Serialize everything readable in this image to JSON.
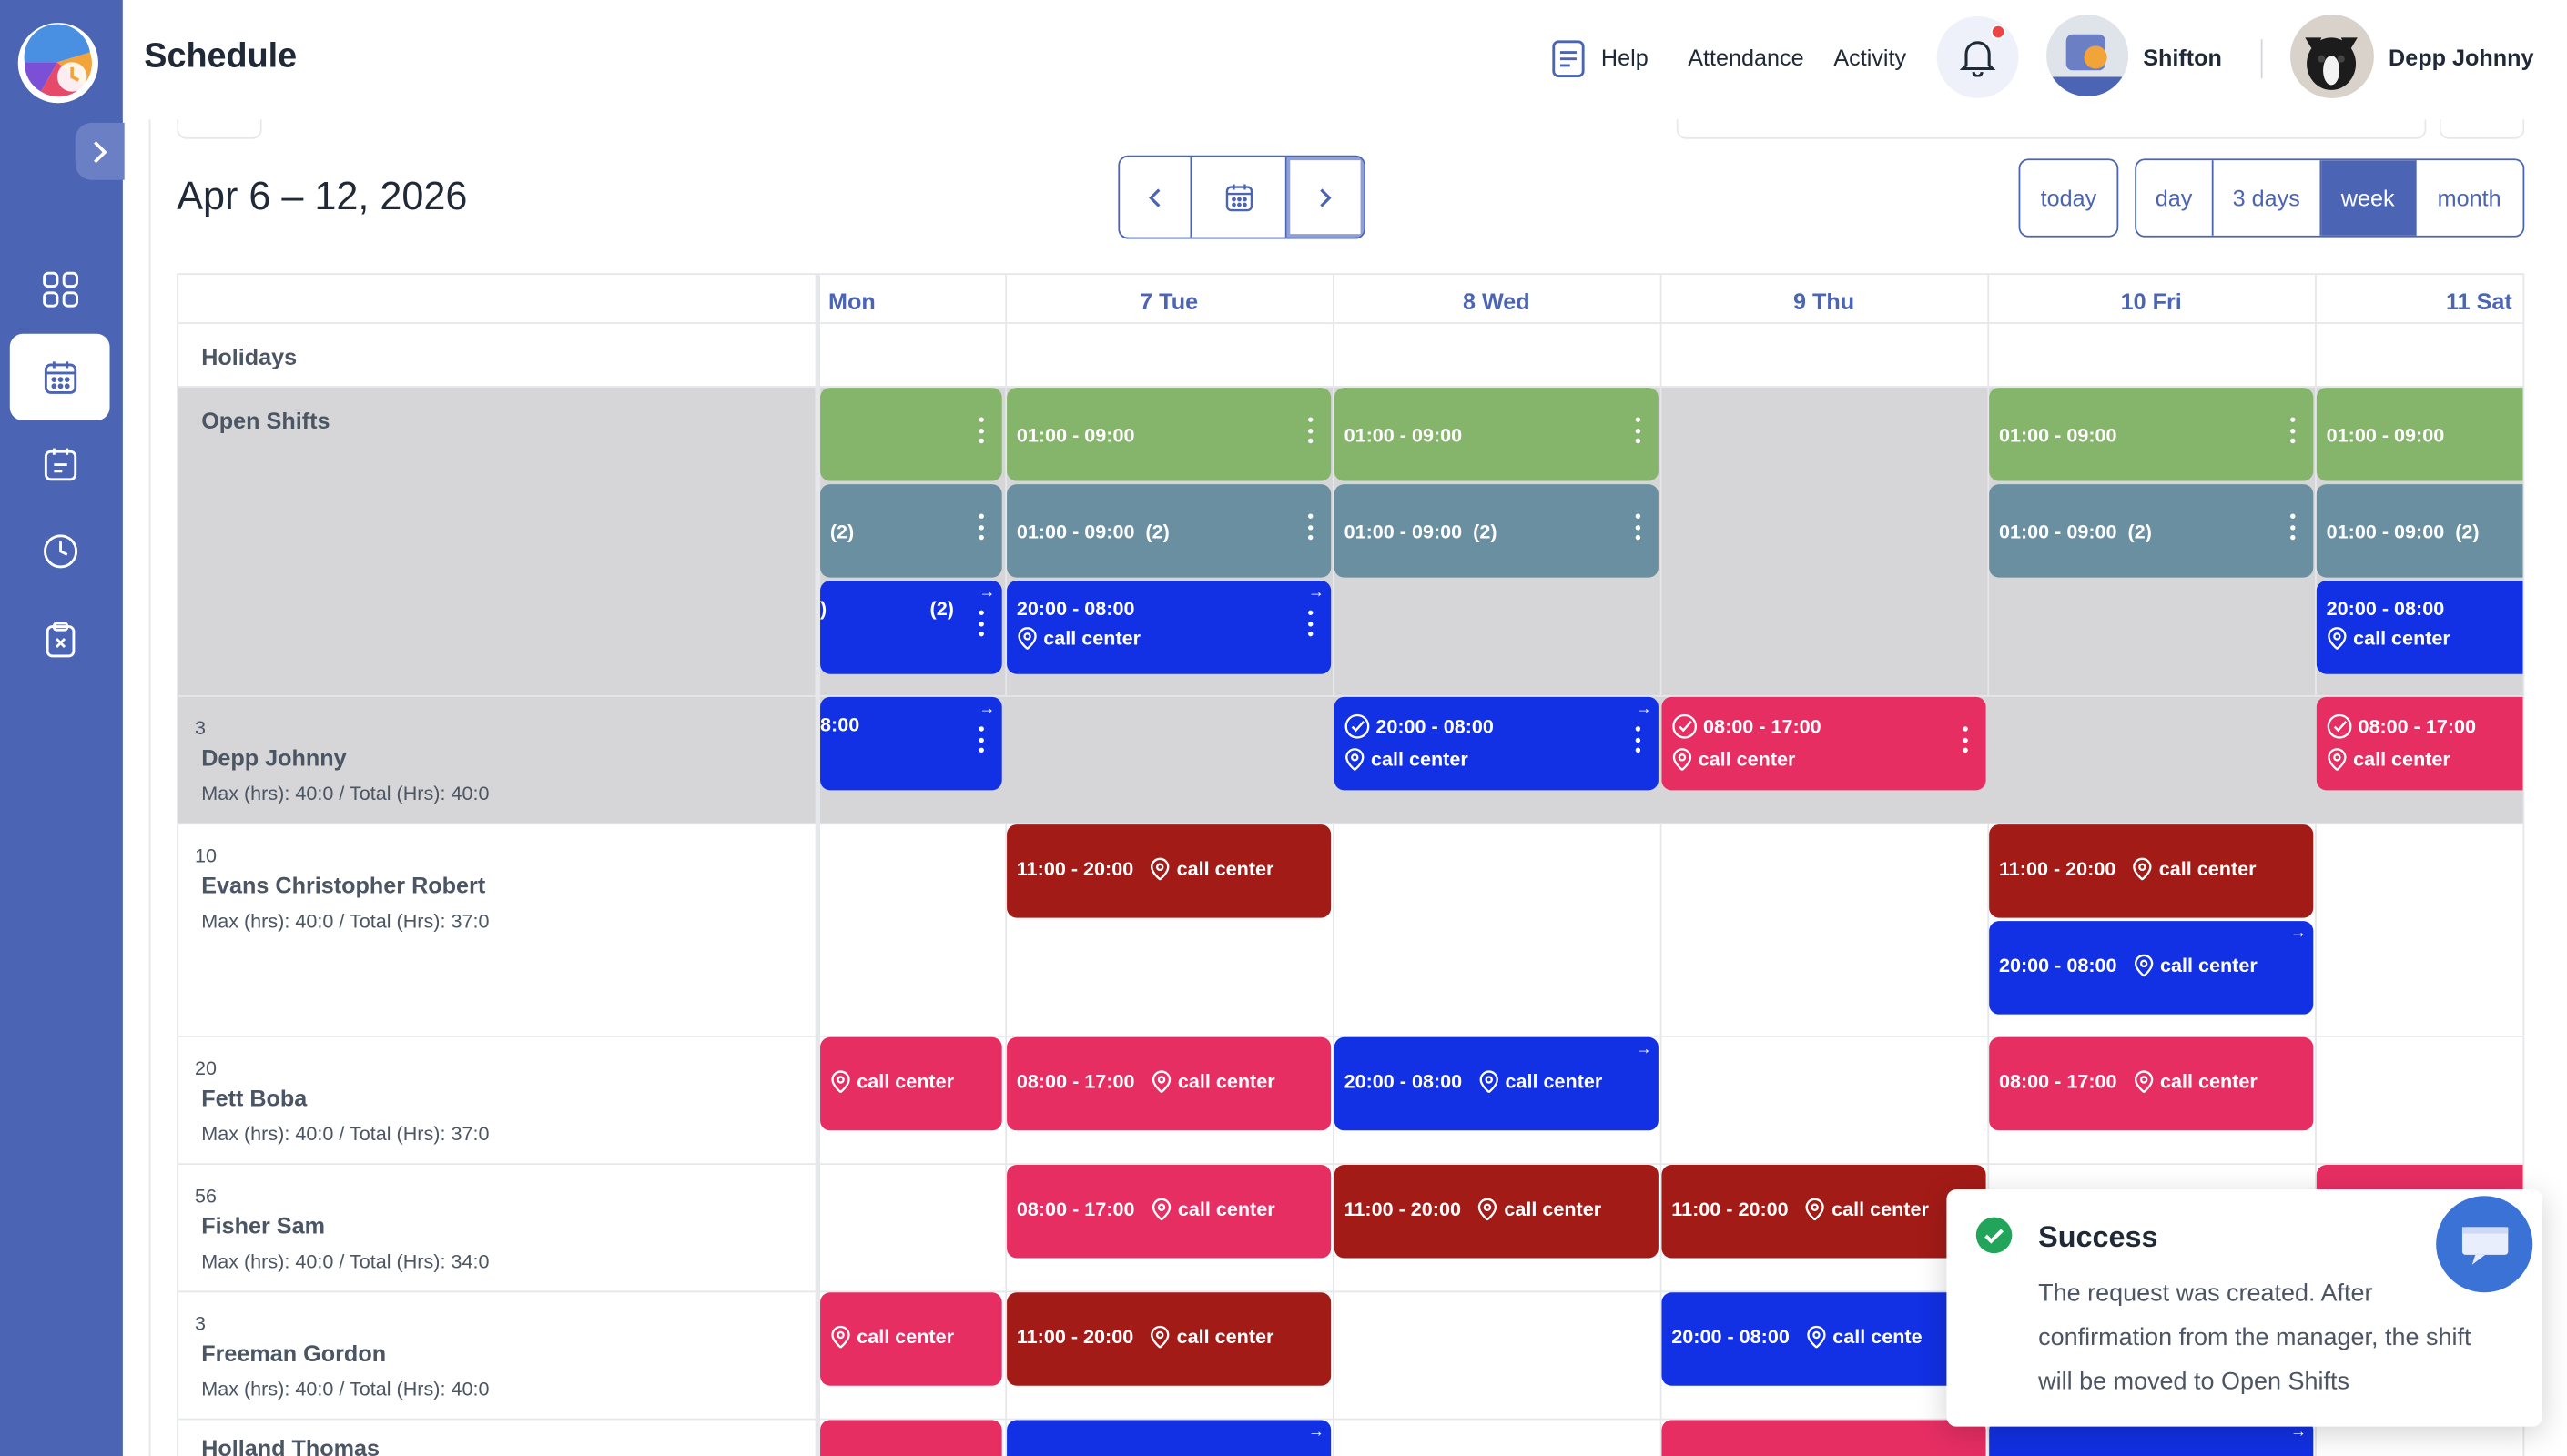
{
  "app": {
    "page_title": "Schedule"
  },
  "header": {
    "help": "Help",
    "attendance": "Attendance",
    "activity": "Activity",
    "company": "Shifton",
    "user": "Depp Johnny"
  },
  "toolbar": {
    "date_range": "Apr 6 – 12, 2026",
    "today": "today",
    "views": [
      "day",
      "3 days",
      "week",
      "month"
    ],
    "active_view": "week"
  },
  "days": [
    "Mon",
    "7 Tue",
    "8 Wed",
    "9 Thu",
    "10 Fri",
    "11 Sat"
  ],
  "rows": {
    "holidays": "Holidays",
    "open_shifts": "Open Shifts",
    "employees": [
      {
        "count": "3",
        "name": "Depp Johnny",
        "hours": "Max (hrs): 40:0 / Total (Hrs): 40:0"
      },
      {
        "count": "10",
        "name": "Evans Christopher Robert",
        "hours": "Max (hrs): 40:0 / Total (Hrs): 37:0"
      },
      {
        "count": "20",
        "name": "Fett Boba",
        "hours": "Max (hrs): 40:0 / Total (Hrs): 37:0"
      },
      {
        "count": "56",
        "name": "Fisher Sam",
        "hours": "Max (hrs): 40:0 / Total (Hrs): 34:0"
      },
      {
        "count": "3",
        "name": "Freeman Gordon",
        "hours": "Max (hrs): 40:0 / Total (Hrs): 40:0"
      },
      {
        "count": "",
        "name": "Holland Thomas",
        "hours": ""
      }
    ]
  },
  "shift_text": {
    "s0109": "01:00 - 09:00",
    "s0109x2": "01:00 - 09:00  (2)",
    "x2": "(2)",
    "s2008": "20:00 - 08:00",
    "s0817": "08:00 - 17:00",
    "s1120": "11:00 - 20:00",
    "call_center": "call center",
    "call_cente": "call cente",
    "partial_08": "8:00",
    "partial_0": ")"
  },
  "toast": {
    "title": "Success",
    "message": "The request was created. After confirmation from the manager, the shift will be moved to Open Shifts"
  },
  "colors": {
    "sidebar": "#4b64b4",
    "accent": "#4b64b4",
    "green": "#84b56a",
    "slate": "#6a8fa0",
    "blue": "#1230e4",
    "pink": "#e62e63",
    "maroon": "#a31b17",
    "success": "#22a55b"
  },
  "icons": {
    "sidebar": [
      "dashboard-icon",
      "calendar-icon",
      "tasks-icon",
      "clock-icon",
      "clipboard-x-icon"
    ],
    "header": [
      "help-book-icon",
      "bell-icon"
    ],
    "shift": [
      "location-pin-icon",
      "check-circle-icon",
      "kebab-menu-icon",
      "arrow-icon"
    ]
  }
}
